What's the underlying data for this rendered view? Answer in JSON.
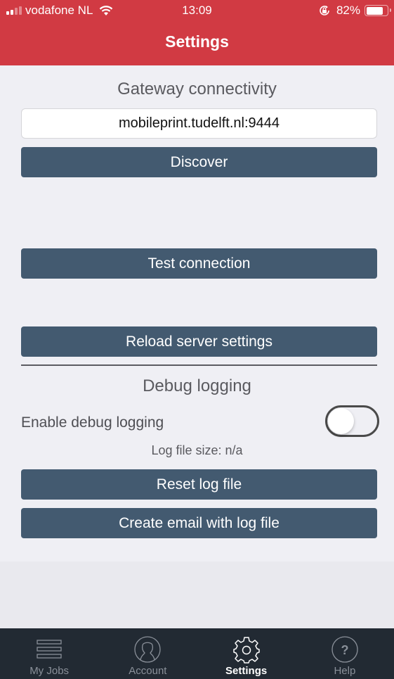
{
  "status_bar": {
    "carrier": "vodafone NL",
    "time": "13:09",
    "battery_percent_label": "82%",
    "battery_level": 0.82
  },
  "header": {
    "title": "Settings",
    "color": "#d13a43"
  },
  "gateway": {
    "section_title": "Gateway connectivity",
    "server_value": "mobileprint.tudelft.nl:9444",
    "discover_label": "Discover",
    "test_connection_label": "Test connection",
    "reload_label": "Reload server settings"
  },
  "debug": {
    "section_title": "Debug logging",
    "enable_label": "Enable debug logging",
    "enabled": false,
    "log_size_label": "Log file size:  n/a",
    "reset_label": "Reset log file",
    "email_label": "Create email with log file"
  },
  "tabbar": {
    "items": [
      {
        "label": "My Jobs",
        "icon": "list-icon",
        "active": false
      },
      {
        "label": "Account",
        "icon": "person-icon",
        "active": false
      },
      {
        "label": "Settings",
        "icon": "gear-icon",
        "active": true
      },
      {
        "label": "Help",
        "icon": "help-icon",
        "active": false
      }
    ]
  }
}
